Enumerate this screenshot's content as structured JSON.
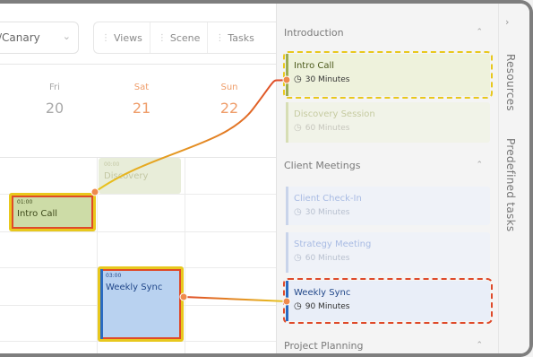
{
  "toolbar": {
    "timezone_value": "/Canary",
    "buttons": [
      {
        "label": "Views"
      },
      {
        "label": "Scene"
      },
      {
        "label": "Tasks"
      }
    ]
  },
  "days": [
    {
      "name": "Fri",
      "number": "20"
    },
    {
      "name": "Sat",
      "number": "21"
    },
    {
      "name": "Sun",
      "number": "22"
    }
  ],
  "events": {
    "discovery": {
      "time": "00:00",
      "title": "Discovery"
    },
    "intro": {
      "time": "01:00",
      "title": "Intro Call"
    },
    "weekly": {
      "time": "03:00",
      "title": "Weekly Sync"
    }
  },
  "sidebar": {
    "sections": [
      {
        "title": "Introduction"
      },
      {
        "title": "Client Meetings"
      },
      {
        "title": "Project Planning"
      }
    ],
    "tasks": {
      "intro": {
        "title": "Intro Call",
        "duration": "30 Minutes"
      },
      "discovery": {
        "title": "Discovery Session",
        "duration": "60 Minutes"
      },
      "checkin": {
        "title": "Client Check-In",
        "duration": "30 Minutes"
      },
      "strategy": {
        "title": "Strategy Meeting",
        "duration": "60 Minutes"
      },
      "weekly": {
        "title": "Weekly Sync",
        "duration": "90 Minutes"
      }
    }
  },
  "vertical_tabs": {
    "resources": "Resources",
    "predefined": "Predefined tasks"
  },
  "colors": {
    "weekend": "#ef9d6a",
    "highlight_yellow": "#e8c81d",
    "highlight_red": "#df4a29",
    "weekly_blue": "#2a6bc2"
  }
}
